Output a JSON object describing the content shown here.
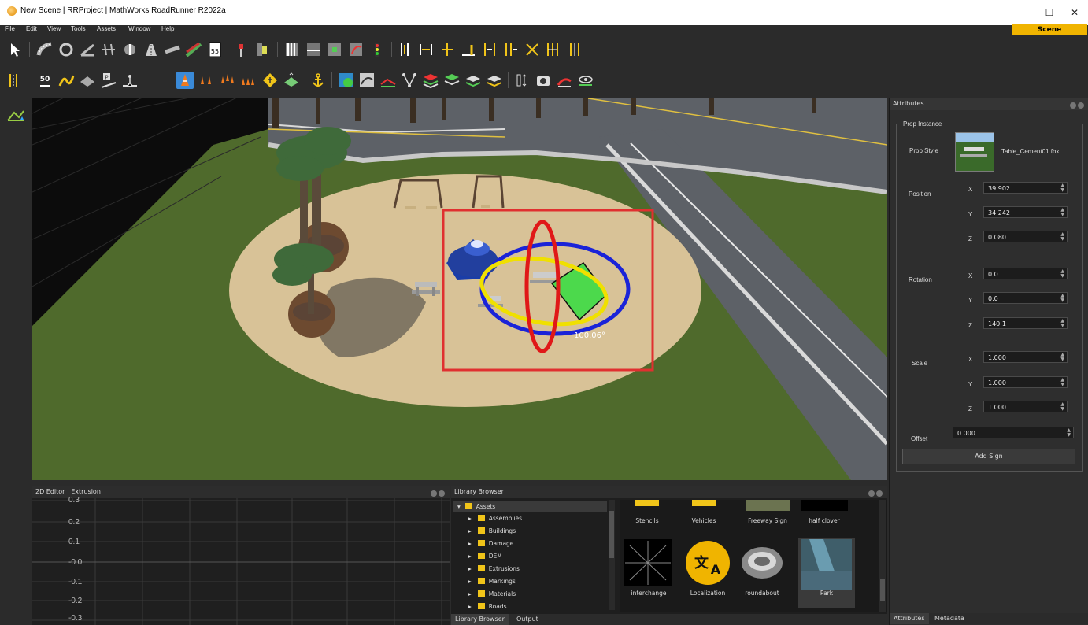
{
  "window": {
    "title": "New Scene | RRProject | MathWorks RoadRunner R2022a",
    "minimize": "–",
    "maximize": "☐",
    "close": "✕"
  },
  "menu": [
    "File",
    "Edit",
    "View",
    "Tools",
    "Assets",
    "Window",
    "Help"
  ],
  "scene_tab": "Scene",
  "viewport": {
    "angle_readout": "100.06°"
  },
  "attributes": {
    "panel_title": "Attributes",
    "group_title": "Prop Instance",
    "prop_style_label": "Prop Style",
    "prop_style_value": "Table_Cement01.fbx",
    "position": {
      "label": "Position",
      "x": "39.902",
      "y": "34.242",
      "z": "0.080"
    },
    "rotation": {
      "label": "Rotation",
      "x": "0.0",
      "y": "0.0",
      "z": "140.1"
    },
    "scale": {
      "label": "Scale",
      "x": "1.000",
      "y": "1.000",
      "z": "1.000"
    },
    "axis_labels": {
      "x": "X",
      "y": "Y",
      "z": "Z"
    },
    "offset": {
      "label": "Offset",
      "value": "0.000"
    },
    "add_sign_button": "Add Sign",
    "bottom_tabs": [
      "Attributes",
      "Metadata"
    ]
  },
  "editor": {
    "title": "2D Editor | Extrusion",
    "y_ticks": [
      "0.3",
      "0.2",
      "0.1",
      "-0.0",
      "-0.1",
      "-0.2",
      "-0.3"
    ]
  },
  "library": {
    "title": "Library Browser",
    "root": "Assets",
    "folders": [
      "Assemblies",
      "Buildings",
      "Damage",
      "DEM",
      "Extrusions",
      "Markings",
      "Materials",
      "Roads"
    ],
    "top_row_assets": [
      "Stencils",
      "Vehicles",
      "Freeway Sign",
      "half clover"
    ],
    "assets": [
      "interchange",
      "Localization",
      "roundabout",
      "Park"
    ],
    "bottom_tabs": [
      "Library Browser",
      "Output"
    ]
  },
  "colors": {
    "accent": "#f0b400",
    "selection_box": "#e03030",
    "gizmo_blue": "#1a23d8",
    "gizmo_yellow": "#f0e000",
    "gizmo_red": "#e01818",
    "sel_green": "#4cd94c"
  }
}
